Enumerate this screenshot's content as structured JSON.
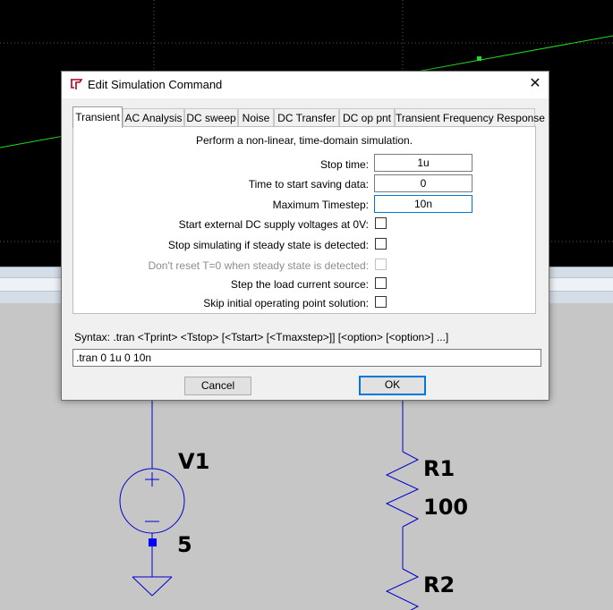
{
  "dialog": {
    "title": "Edit Simulation Command",
    "close_glyph": "✕",
    "tabs": [
      {
        "label": "Transient",
        "active": true
      },
      {
        "label": "AC Analysis"
      },
      {
        "label": "DC sweep"
      },
      {
        "label": "Noise"
      },
      {
        "label": "DC Transfer"
      },
      {
        "label": "DC op pnt"
      },
      {
        "label": "Transient Frequency Response"
      }
    ],
    "description": "Perform a non-linear, time-domain simulation.",
    "fields": [
      {
        "label": "Stop time:",
        "value": "1u"
      },
      {
        "label": "Time to start saving data:",
        "value": "0"
      },
      {
        "label": "Maximum Timestep:",
        "value": "10n"
      }
    ],
    "options": [
      {
        "label": "Start external DC supply voltages at 0V:",
        "checked": false,
        "disabled": false
      },
      {
        "label": "Stop simulating if steady state is detected:",
        "checked": false,
        "disabled": false
      },
      {
        "label": "Don't reset T=0 when steady state is detected:",
        "checked": false,
        "disabled": true
      },
      {
        "label": "Step the load current source:",
        "checked": false,
        "disabled": false
      },
      {
        "label": "Skip initial operating point solution:",
        "checked": false,
        "disabled": false
      }
    ],
    "syntax": "Syntax:  .tran <Tprint> <Tstop> [<Tstart> [<Tmaxstep>]] [<option> [<option>] ...]",
    "command": ".tran 0 1u 0 10n",
    "buttons": {
      "cancel": "Cancel",
      "ok": "OK"
    }
  },
  "schematic": {
    "source_name": "V1",
    "source_value": "5",
    "resistor1_name": "R1",
    "resistor1_value": "100",
    "resistor2_name": "R2"
  },
  "colors": {
    "plot_background": "#000000",
    "trace": "#22dd22",
    "wire": "#0000cc",
    "schematic_background": "#c6c6c6",
    "dialog_background": "#f0f0f0",
    "focus_accent": "#0078d7"
  }
}
